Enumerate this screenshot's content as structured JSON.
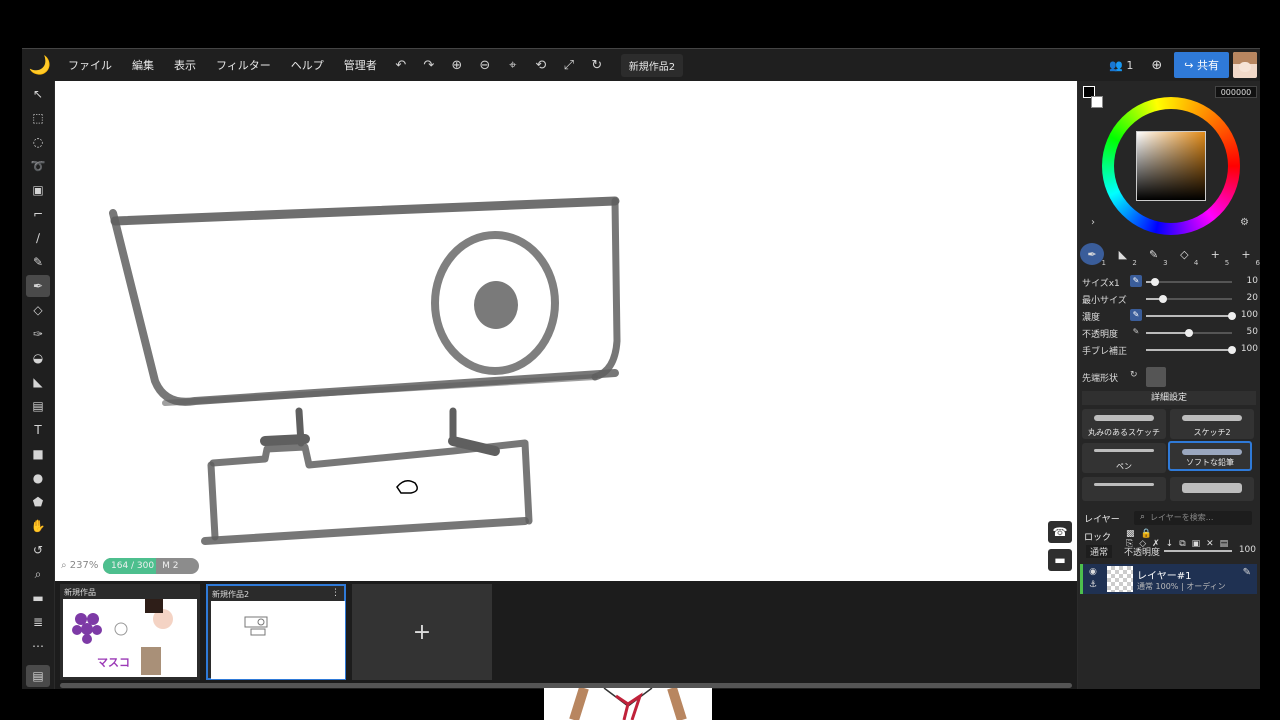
{
  "menu": {
    "items": [
      "ファイル",
      "編集",
      "表示",
      "フィルター",
      "ヘルプ",
      "管理者"
    ],
    "document_title": "新規作品2"
  },
  "header_right": {
    "user_count": "1",
    "share_label": "共有"
  },
  "canvas": {
    "zoom": "237%",
    "size_indicator": "164 / 300",
    "memory": "M 2",
    "size_fill_fraction": 0.55
  },
  "color": {
    "hex": "000000",
    "foreground": "#000000",
    "background": "#ffffff"
  },
  "brush_slots": [
    "1",
    "2",
    "3",
    "4",
    "5",
    "6"
  ],
  "brush_params": [
    {
      "label": "サイズx1",
      "value": "10",
      "level": 0.1
    },
    {
      "label": "最小サイズ",
      "value": "20",
      "level": 0.2
    },
    {
      "label": "濃度",
      "value": "100",
      "level": 1.0
    },
    {
      "label": "不透明度",
      "value": "50",
      "level": 0.5
    },
    {
      "label": "手ブレ補正",
      "value": "100",
      "level": 1.0
    }
  ],
  "tip_label": "先端形状",
  "detail_label": "詳細設定",
  "presets": [
    "丸みのあるスケッチ",
    "スケッチ2",
    "ペン",
    "ソフトな鉛筆"
  ],
  "layers": {
    "title": "レイヤー",
    "search_placeholder": "レイヤーを検索...",
    "lock_label": "ロック",
    "blend_mode": "通常",
    "opacity_label": "不透明度",
    "opacity_value": "100",
    "items": [
      {
        "name": "レイヤー#1",
        "meta": "通常 100% | オーディン"
      }
    ]
  },
  "thumbnails": [
    {
      "name": "新規作品"
    },
    {
      "name": "新規作品2"
    }
  ],
  "thumb_caption": "マスコ",
  "accent_color": "#2f7ad8"
}
